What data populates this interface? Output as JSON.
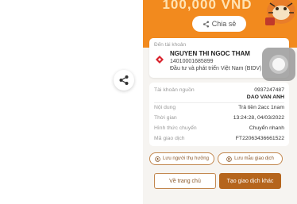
{
  "banner": {
    "amount": "100,000 VND",
    "share_label": "Chia sẻ"
  },
  "destination": {
    "title": "Đến tài khoản",
    "name": "NGUYEN THI NGOC THAM",
    "account": "14010001685899",
    "bank": "Đầu tư và phát triển Việt Nam (BIDV)"
  },
  "details": {
    "source_label": "Tài khoản nguồn",
    "source_account": "0937247487",
    "source_name": "DAO VAN ANH",
    "content_label": "Nội dung",
    "content_value": "Trả tiền 2acc 1nam",
    "time_label": "Thời gian",
    "time_value": "13:24:28, 04/03/2022",
    "method_label": "Hình thức chuyển",
    "method_value": "Chuyển nhanh",
    "txn_label": "Mã giao dịch",
    "txn_value": "FT22063436661522"
  },
  "actions": {
    "save_recipient": "Lưu người thụ hưởng",
    "save_template": "Lưu mẫu giao dịch",
    "home": "Về trang chủ",
    "new_transaction": "Tạo giao dịch khác"
  },
  "colors": {
    "banner": "#f28a1e",
    "primary": "#b5651d",
    "outline": "#c2874e"
  }
}
